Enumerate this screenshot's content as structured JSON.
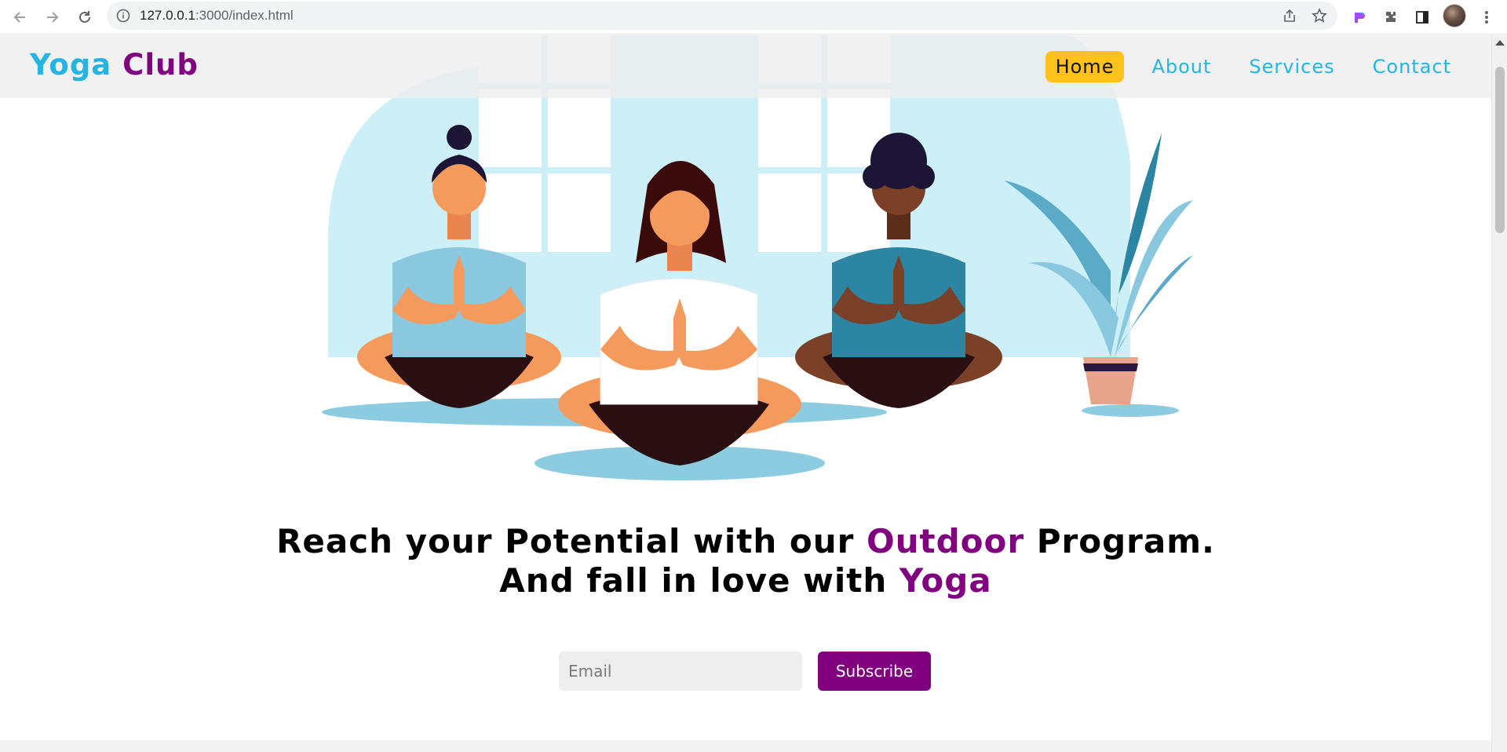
{
  "browser": {
    "url_host": "127.0.0.1",
    "url_path": ":3000/index.html",
    "icons": [
      "back-arrow-icon",
      "forward-arrow-icon",
      "reload-icon",
      "site-info-icon",
      "share-icon",
      "bookmark-star-icon",
      "extension-color-icon",
      "puzzle-extensions-icon",
      "side-panel-icon",
      "profile-avatar",
      "kebab-menu-icon"
    ]
  },
  "header": {
    "logo_part1": "Yoga",
    "logo_part2": "Club",
    "nav": [
      {
        "label": "Home",
        "active": true
      },
      {
        "label": "About",
        "active": false
      },
      {
        "label": "Services",
        "active": false
      },
      {
        "label": "Contact",
        "active": false
      }
    ]
  },
  "hero": {
    "line1_pre": "Reach your Potential with our ",
    "line1_accent": "Outdoor",
    "line1_post": " Program.",
    "line2_pre": "And fall in love with ",
    "line2_accent": "Yoga"
  },
  "subscribe": {
    "email_placeholder": "Email",
    "button_label": "Subscribe"
  },
  "colors": {
    "brand_blue": "#25b5e0",
    "brand_purple": "#800080",
    "active_nav": "#ffc21a",
    "illustration_bg": "#cdeff7"
  }
}
